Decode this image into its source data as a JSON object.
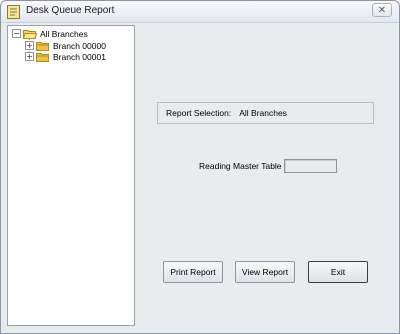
{
  "window": {
    "title": "Desk Queue Report",
    "close_glyph": "✕"
  },
  "tree": {
    "root": {
      "label": "All Branches",
      "expander": "−"
    },
    "children": [
      {
        "label": "Branch 00000",
        "expander": "+"
      },
      {
        "label": "Branch 00001",
        "expander": "+"
      }
    ]
  },
  "report_selection": {
    "label": "Report Selection:",
    "value": "All Branches"
  },
  "reading": {
    "label": "Reading Master Table",
    "value": ""
  },
  "buttons": {
    "print": "Print Report",
    "view": "View Report",
    "exit": "Exit"
  },
  "icons": {
    "app": "report-icon",
    "folder": "folder-icon",
    "close": "close-icon"
  },
  "colors": {
    "folder": "#e8c44a",
    "background": "#e9ebee"
  }
}
